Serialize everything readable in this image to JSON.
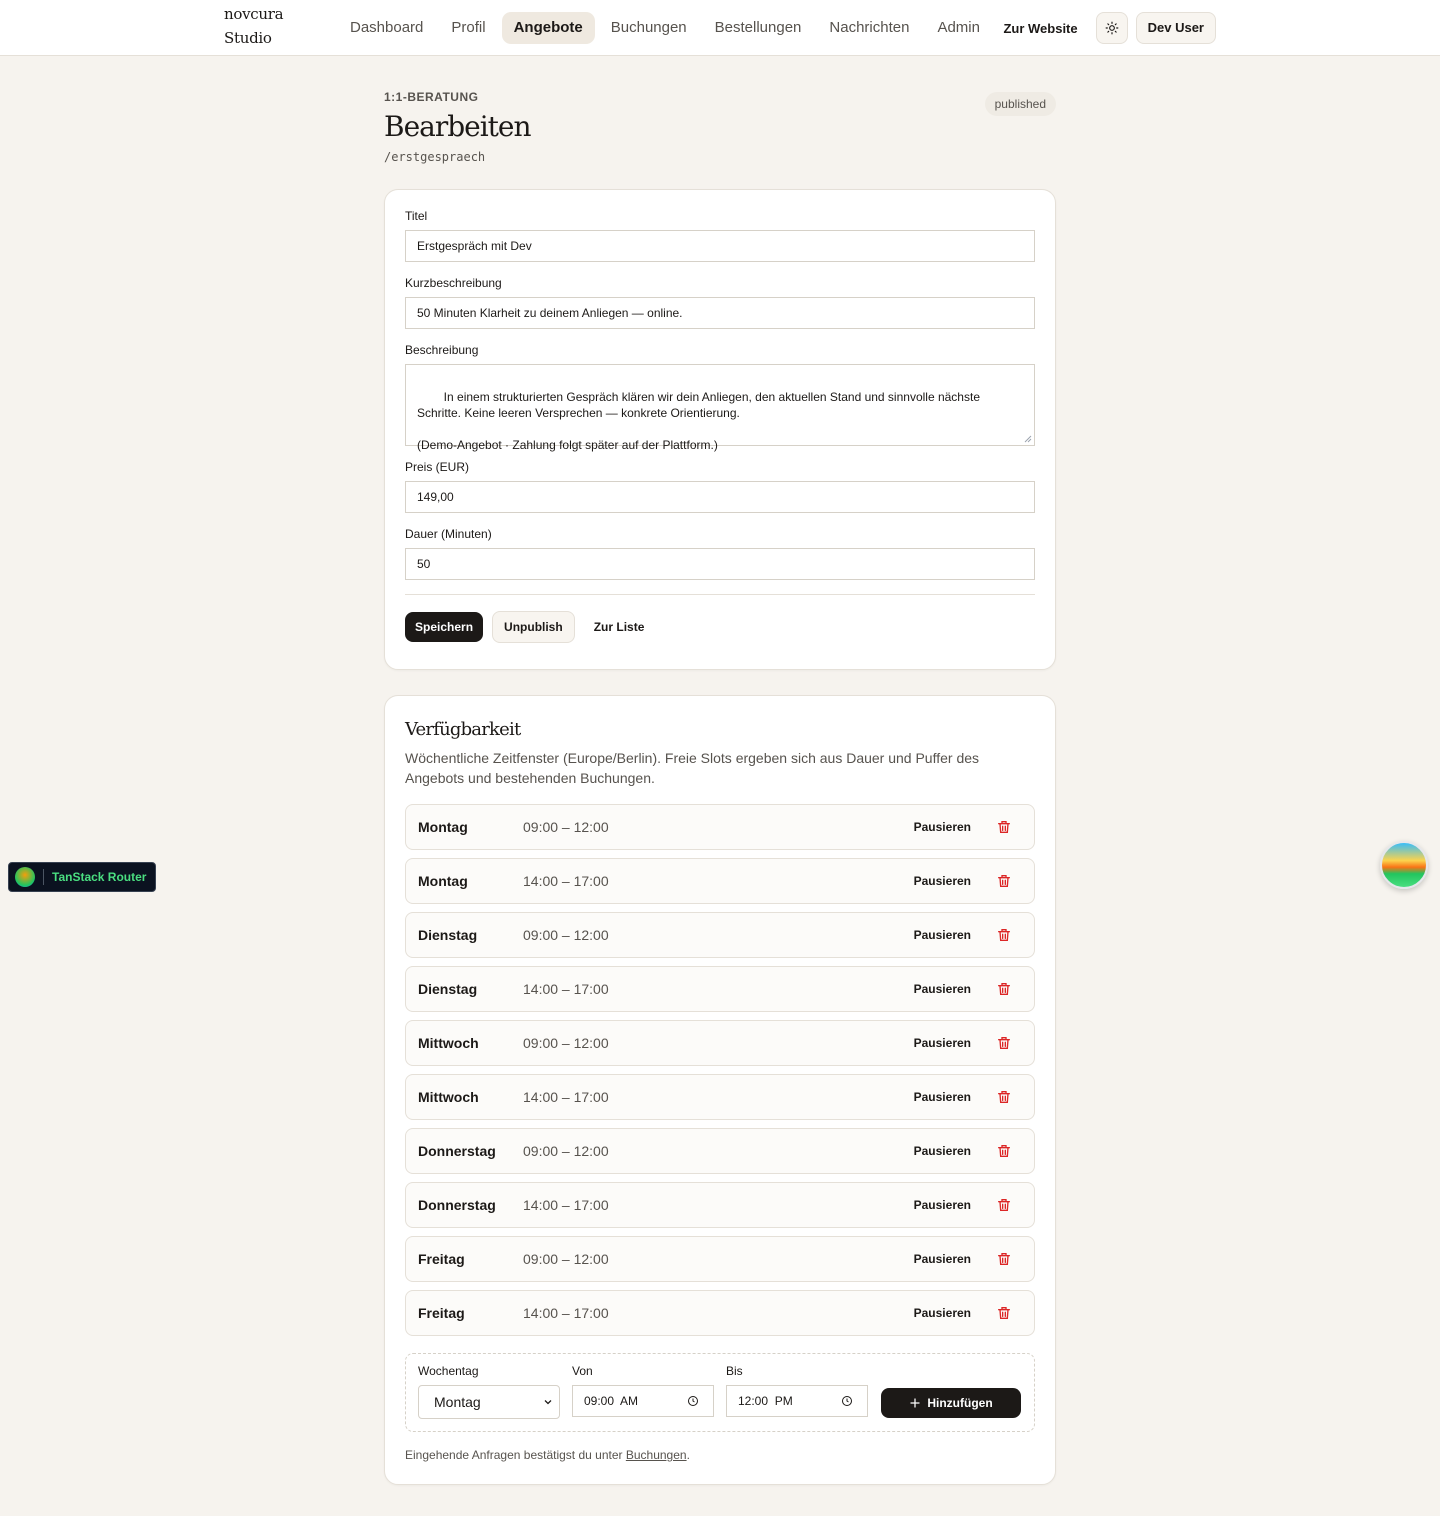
{
  "brand": {
    "line1": "novcura",
    "line2": "Studio"
  },
  "nav": {
    "items": [
      {
        "label": "Dashboard",
        "active": false
      },
      {
        "label": "Profil",
        "active": false
      },
      {
        "label": "Angebote",
        "active": true
      },
      {
        "label": "Buchungen",
        "active": false
      },
      {
        "label": "Bestellungen",
        "active": false
      },
      {
        "label": "Nachrichten",
        "active": false
      },
      {
        "label": "Admin",
        "active": false
      }
    ],
    "website_link": "Zur Website",
    "theme_icon": "sun-icon",
    "user_label": "Dev User"
  },
  "page": {
    "kicker": "1:1-BERATUNG",
    "status": "published",
    "title": "Bearbeiten",
    "slug": "/erstgespraech"
  },
  "form": {
    "title_label": "Titel",
    "title_value": "Erstgespräch mit Dev",
    "short_label": "Kurzbeschreibung",
    "short_value": "50 Minuten Klarheit zu deinem Anliegen — online.",
    "desc_label": "Beschreibung",
    "desc_value": "In einem strukturierten Gespräch klären wir dein Anliegen, den aktuellen Stand und sinnvolle nächste Schritte. Keine leeren Versprechen — konkrete Orientierung.\n\n(Demo-Angebot · Zahlung folgt später auf der Plattform.)",
    "price_label": "Preis (EUR)",
    "price_value": "149,00",
    "duration_label": "Dauer (Minuten)",
    "duration_value": "50",
    "save_label": "Speichern",
    "unpublish_label": "Unpublish",
    "back_label": "Zur Liste"
  },
  "availability": {
    "title": "Verfügbarkeit",
    "description": "Wöchentliche Zeitfenster (Europe/Berlin). Freie Slots ergeben sich aus Dauer und Puffer des Angebots und bestehenden Buchungen.",
    "slots": [
      {
        "day": "Montag",
        "time": "09:00 – 12:00",
        "pause": "Pausieren"
      },
      {
        "day": "Montag",
        "time": "14:00 – 17:00",
        "pause": "Pausieren"
      },
      {
        "day": "Dienstag",
        "time": "09:00 – 12:00",
        "pause": "Pausieren"
      },
      {
        "day": "Dienstag",
        "time": "14:00 – 17:00",
        "pause": "Pausieren"
      },
      {
        "day": "Mittwoch",
        "time": "09:00 – 12:00",
        "pause": "Pausieren"
      },
      {
        "day": "Mittwoch",
        "time": "14:00 – 17:00",
        "pause": "Pausieren"
      },
      {
        "day": "Donnerstag",
        "time": "09:00 – 12:00",
        "pause": "Pausieren"
      },
      {
        "day": "Donnerstag",
        "time": "14:00 – 17:00",
        "pause": "Pausieren"
      },
      {
        "day": "Freitag",
        "time": "09:00 – 12:00",
        "pause": "Pausieren"
      },
      {
        "day": "Freitag",
        "time": "14:00 – 17:00",
        "pause": "Pausieren"
      }
    ],
    "add": {
      "weekday_label": "Wochentag",
      "weekday_value": "Montag",
      "from_label": "Von",
      "from_value": "09:00  AM",
      "to_label": "Bis",
      "to_value": "12:00  PM",
      "add_label": "Hinzufügen"
    },
    "footnote_prefix": "Eingehende Anfragen bestätigst du unter ",
    "footnote_link": "Buchungen",
    "footnote_suffix": "."
  },
  "devtools": {
    "router_label": "TanStack Router"
  },
  "colors": {
    "accent": "#1c1917",
    "background": "#f6f3ee",
    "danger": "#dc2626",
    "router_green": "#4ade80"
  }
}
